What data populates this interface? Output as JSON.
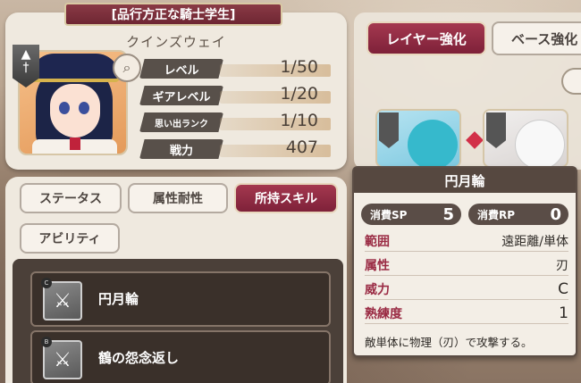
{
  "character": {
    "title": "[品行方正な騎士学生]",
    "name": "クインズウェイ",
    "stats": [
      {
        "label": "レベル",
        "value": "1/50"
      },
      {
        "label": "ギアレベル",
        "value": "1/20"
      },
      {
        "label": "思い出ランク",
        "value": "1/10"
      },
      {
        "label": "戦力",
        "value": "407"
      }
    ]
  },
  "enhance_tabs": {
    "layer": "レイヤー強化",
    "base": "ベース強化"
  },
  "info_tabs": [
    {
      "label": "ステータス",
      "active": false
    },
    {
      "label": "属性耐性",
      "active": false
    },
    {
      "label": "所持スキル",
      "active": true
    },
    {
      "label": "アビリティ",
      "active": false
    }
  ],
  "skills": [
    {
      "name": "円月輪",
      "rank": "C"
    },
    {
      "name": "鶴の怨念返し",
      "rank": "B"
    }
  ],
  "skill_detail": {
    "title": "円月輪",
    "sp_label": "消費SP",
    "sp_value": "5",
    "rp_label": "消費RP",
    "rp_value": "0",
    "attributes": [
      {
        "label": "範囲",
        "value": "遠距離/単体"
      },
      {
        "label": "属性",
        "value": "刃"
      },
      {
        "label": "威力",
        "value": "C"
      },
      {
        "label": "熟練度",
        "value": "1"
      }
    ],
    "description": "敵単体に物理（刃）で攻撃する。"
  },
  "colors": {
    "accent": "#8a2a42",
    "panel": "#efe9df",
    "dark_panel": "#4b4039"
  }
}
